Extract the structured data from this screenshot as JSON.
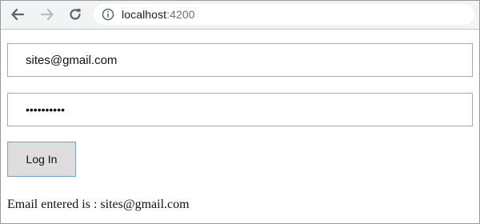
{
  "browser": {
    "url_host": "localhost",
    "url_port": ":4200",
    "icons": {
      "back": "back-arrow-icon",
      "forward": "forward-arrow-icon",
      "reload": "reload-icon",
      "info": "info-icon"
    }
  },
  "form": {
    "email_value": "sites@gmail.com",
    "password_value": "••••••••••",
    "login_label": "Log In"
  },
  "result": {
    "text": "Email entered is : sites@gmail.com"
  }
}
